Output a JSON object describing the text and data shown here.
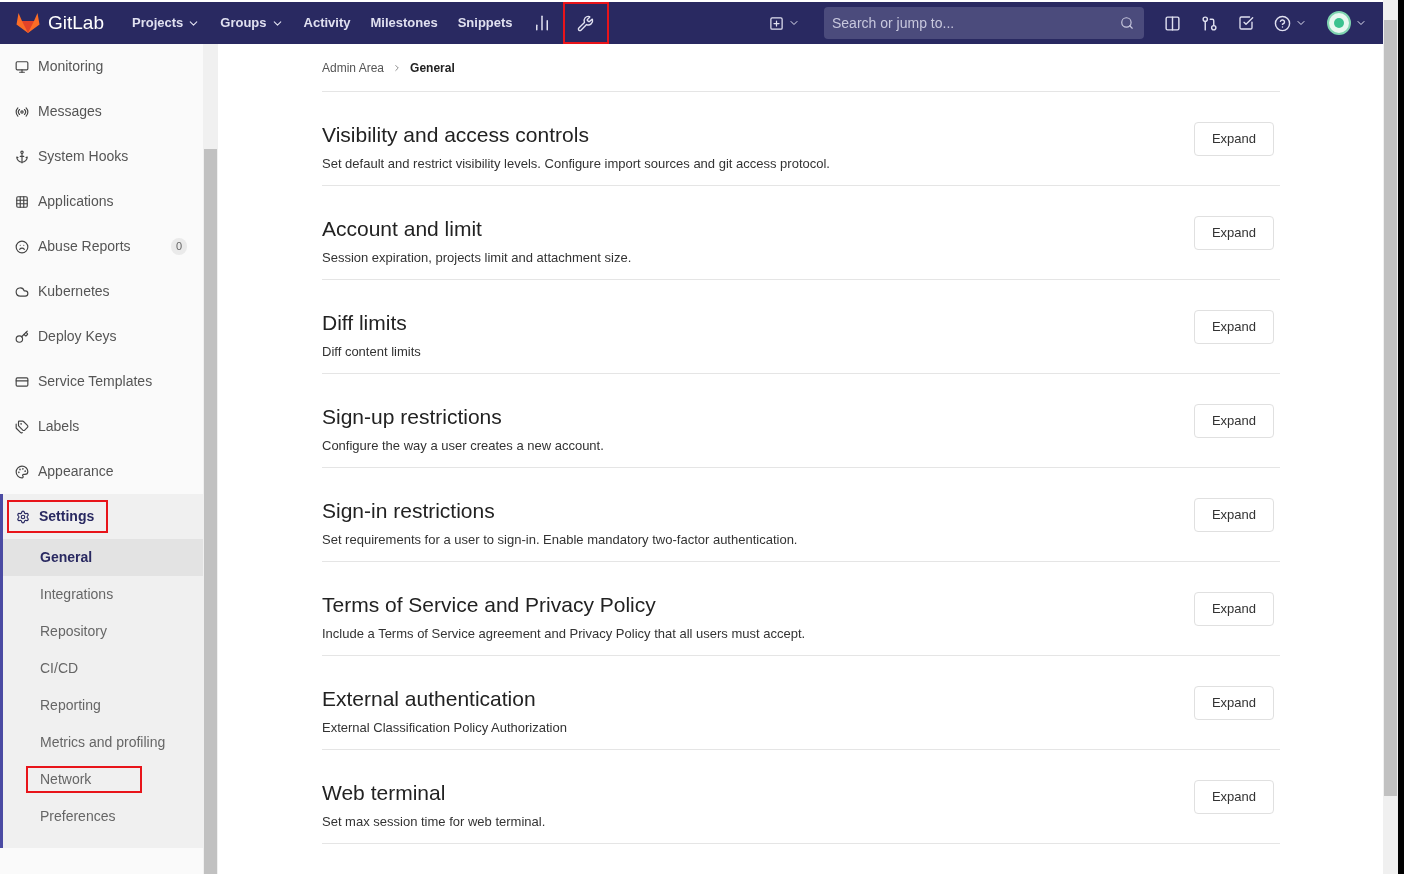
{
  "navbar": {
    "brand": "GitLab",
    "links": [
      {
        "label": "Projects",
        "dropdown": true
      },
      {
        "label": "Groups",
        "dropdown": true
      },
      {
        "label": "Activity",
        "dropdown": false
      },
      {
        "label": "Milestones",
        "dropdown": false
      },
      {
        "label": "Snippets",
        "dropdown": false
      }
    ],
    "admin_highlighted": true,
    "search": {
      "placeholder": "Search or jump to..."
    }
  },
  "sidebar": {
    "items": [
      {
        "label": "Monitoring"
      },
      {
        "label": "Messages"
      },
      {
        "label": "System Hooks"
      },
      {
        "label": "Applications"
      },
      {
        "label": "Abuse Reports",
        "count": "0"
      },
      {
        "label": "Kubernetes"
      },
      {
        "label": "Deploy Keys"
      },
      {
        "label": "Service Templates"
      },
      {
        "label": "Labels"
      },
      {
        "label": "Appearance"
      }
    ],
    "settings": {
      "label": "Settings",
      "highlighted": true,
      "children": [
        {
          "label": "General",
          "selected": true,
          "highlighted": false
        },
        {
          "label": "Integrations",
          "selected": false,
          "highlighted": false
        },
        {
          "label": "Repository",
          "selected": false,
          "highlighted": false
        },
        {
          "label": "CI/CD",
          "selected": false,
          "highlighted": false
        },
        {
          "label": "Reporting",
          "selected": false,
          "highlighted": false
        },
        {
          "label": "Metrics and profiling",
          "selected": false,
          "highlighted": false
        },
        {
          "label": "Network",
          "selected": false,
          "highlighted": true
        },
        {
          "label": "Preferences",
          "selected": false,
          "highlighted": false
        }
      ]
    }
  },
  "breadcrumb": [
    "Admin Area",
    "General"
  ],
  "sections": [
    {
      "title": "Visibility and access controls",
      "description": "Set default and restrict visibility levels. Configure import sources and git access protocol.",
      "button": "Expand"
    },
    {
      "title": "Account and limit",
      "description": "Session expiration, projects limit and attachment size.",
      "button": "Expand"
    },
    {
      "title": "Diff limits",
      "description": "Diff content limits",
      "button": "Expand"
    },
    {
      "title": "Sign-up restrictions",
      "description": "Configure the way a user creates a new account.",
      "button": "Expand"
    },
    {
      "title": "Sign-in restrictions",
      "description": "Set requirements for a user to sign-in. Enable mandatory two-factor authentication.",
      "button": "Expand"
    },
    {
      "title": "Terms of Service and Privacy Policy",
      "description": "Include a Terms of Service agreement and Privacy Policy that all users must accept.",
      "button": "Expand"
    },
    {
      "title": "External authentication",
      "description": "External Classification Policy Authorization",
      "button": "Expand"
    },
    {
      "title": "Web terminal",
      "description": "Set max session time for web terminal.",
      "button": "Expand"
    }
  ]
}
